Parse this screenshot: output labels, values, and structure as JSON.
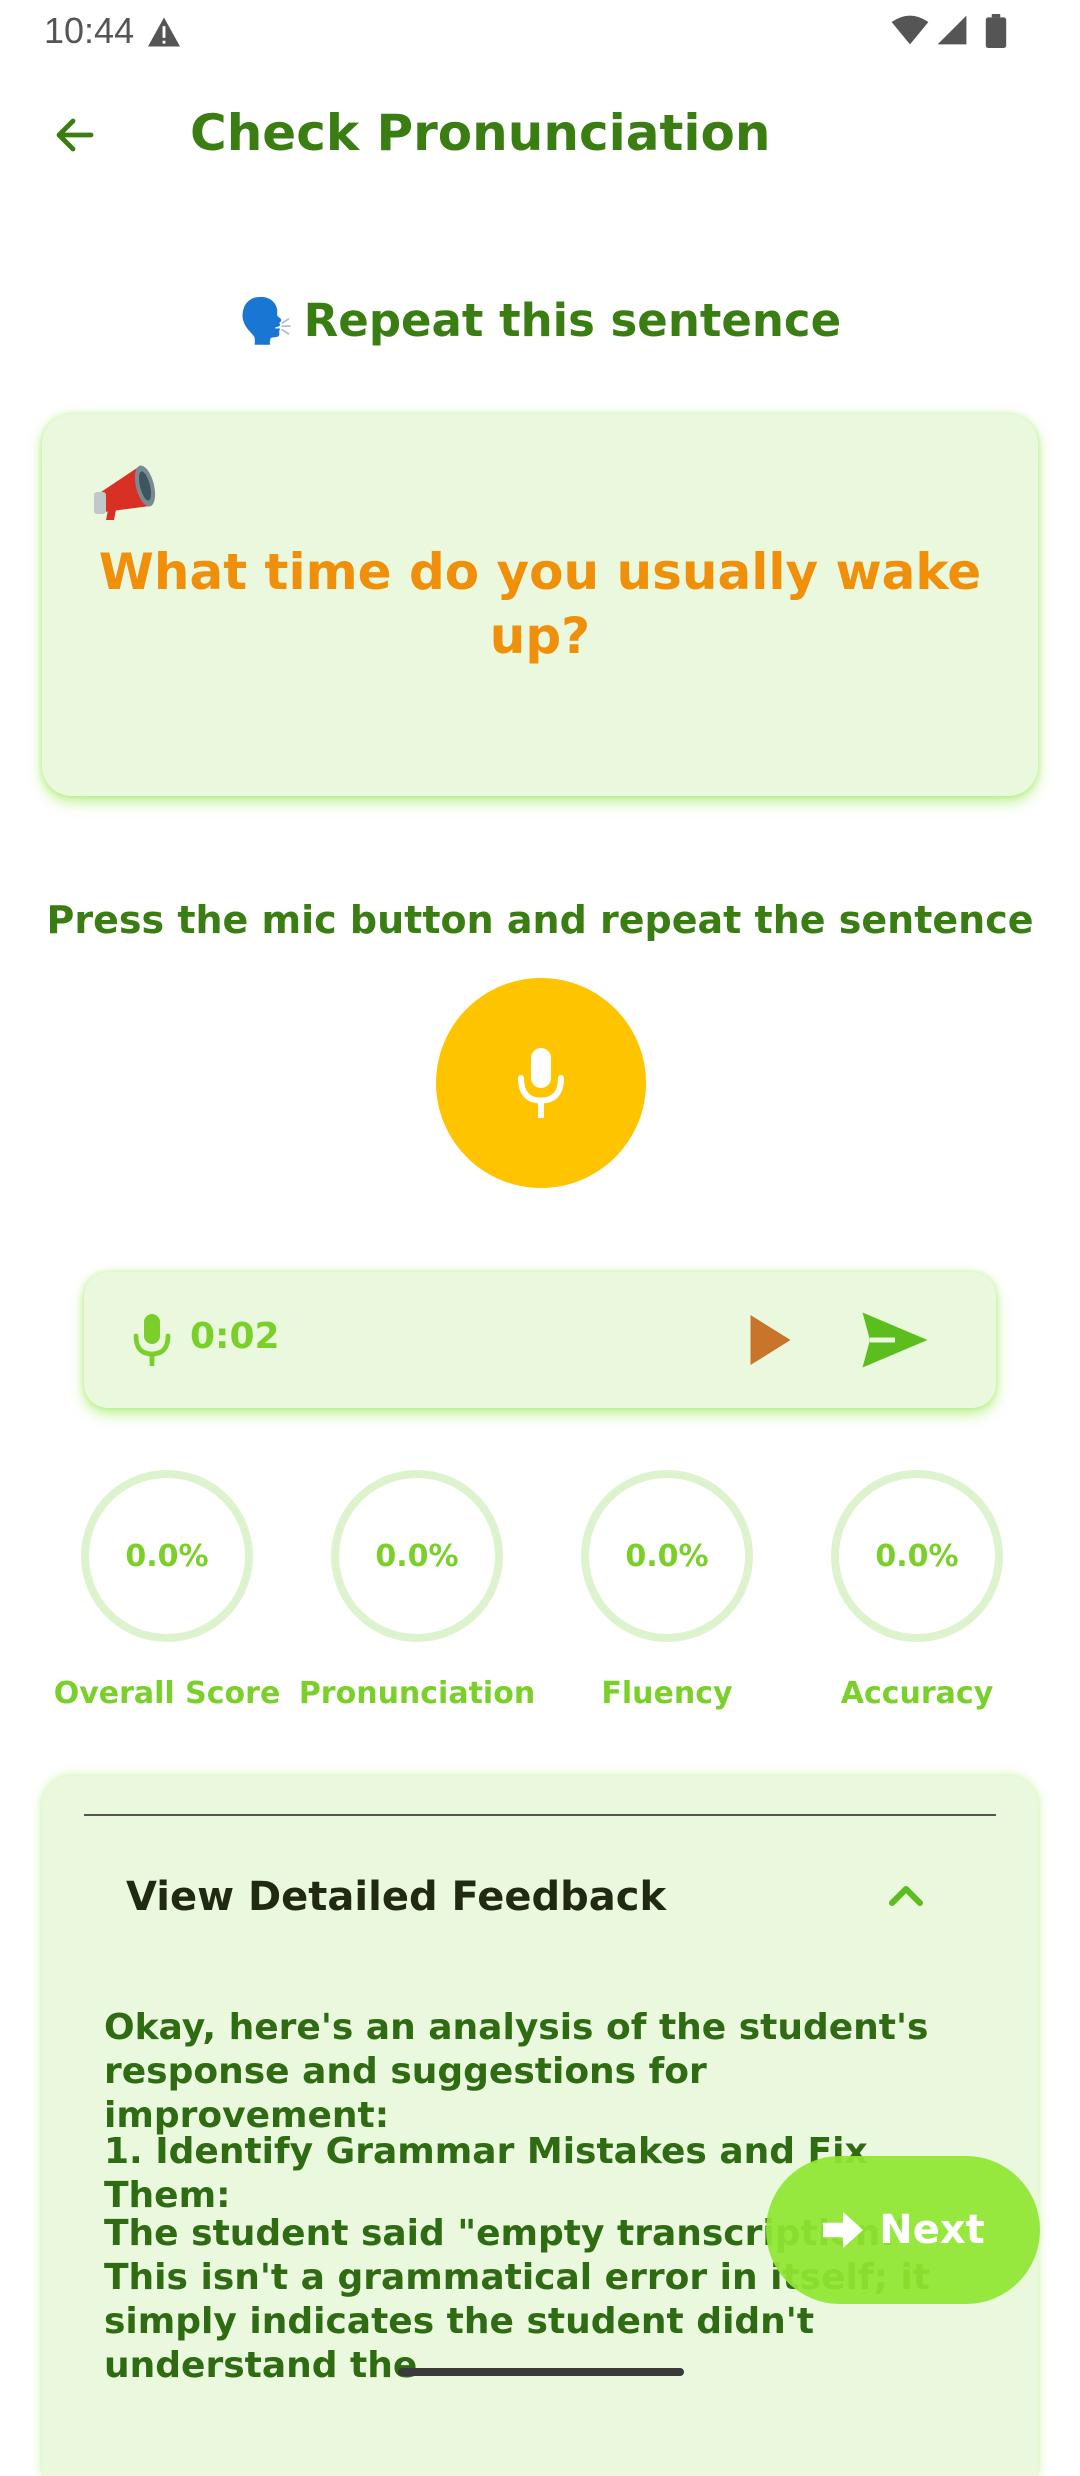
{
  "status_bar": {
    "time": "10:44"
  },
  "header": {
    "title": "Check Pronunciation"
  },
  "prompt": {
    "emoji": "🗣️",
    "heading": "Repeat this sentence"
  },
  "sentence_card": {
    "icon": "megaphone-icon",
    "sentence": "What time do you usually wake up?"
  },
  "recorder": {
    "instruction": "Press the mic button and repeat the sentence",
    "duration": "0:02"
  },
  "scores": [
    {
      "label": "Overall Score",
      "value": "0.0%"
    },
    {
      "label": "Pronunciation",
      "value": "0.0%"
    },
    {
      "label": "Fluency",
      "value": "0.0%"
    },
    {
      "label": "Accuracy",
      "value": "0.0%"
    }
  ],
  "feedback": {
    "title": "View Detailed Feedback",
    "paragraphs": [
      "Okay, here's an analysis of the student's response and suggestions for improvement:",
      "1. Identify Grammar Mistakes and Fix Them:",
      "The student said \"empty transcription.\" This isn't a grammatical error in itself; it simply indicates the student didn't understand the"
    ]
  },
  "next_button": {
    "label": "Next"
  },
  "colors": {
    "primary_green": "#3a7d12",
    "light_green": "#7bcf2a",
    "accent_orange": "#ef8f0a",
    "mic_yellow": "#ffc400",
    "card_bg": "#eaf8dd"
  }
}
